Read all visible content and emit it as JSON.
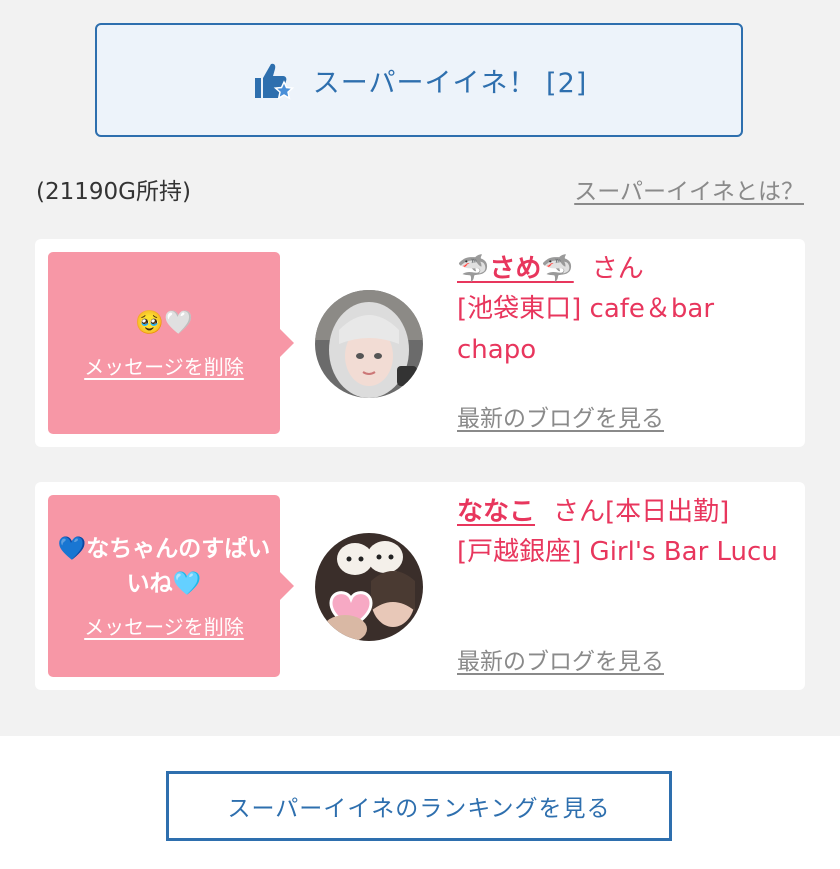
{
  "super_button": {
    "label": "スーパーイイネ！ [2]",
    "icon": "thumbs-up-star-icon",
    "color": "#2e6fae"
  },
  "gold_text": "(21190G所持)",
  "about_link": "スーパーイイネとは？",
  "entries": [
    {
      "message": "🥹🤍",
      "delete_label": "メッセージを削除",
      "name": "🦈さめ🦈",
      "suffix": "さん",
      "shop": "[池袋東口] cafe＆bar chapo",
      "blog_link": "最新のブログを見る"
    },
    {
      "message": "💙なちゃんのすぱいいね🩵",
      "delete_label": "メッセージを削除",
      "name": "ななこ",
      "suffix": "さん[本日出勤]",
      "shop": "[戸越銀座] Girl's Bar Lucu",
      "blog_link": "最新のブログを見る"
    }
  ],
  "ranking_button": "スーパーイイネのランキングを見る",
  "colors": {
    "accent": "#2e6fae",
    "bubble": "#f797a6",
    "name": "#e8365d",
    "link_gray": "#8a8a8a"
  }
}
